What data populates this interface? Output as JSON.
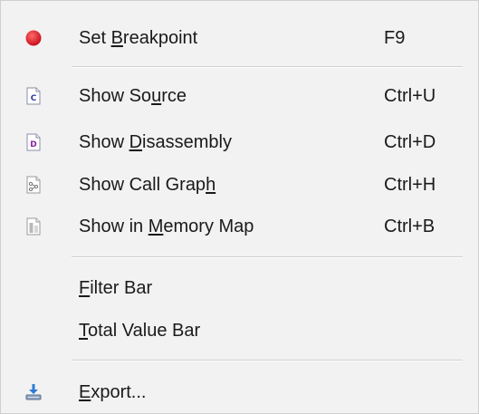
{
  "menu": {
    "items": [
      {
        "pre": "Set ",
        "accel": "B",
        "post": "reakpoint",
        "shortcut": "F9",
        "icon": "breakpoint-icon"
      },
      {
        "pre": "Show So",
        "accel": "u",
        "post": "rce",
        "shortcut": "Ctrl+U",
        "icon": "source-file-icon"
      },
      {
        "pre": "Show ",
        "accel": "D",
        "post": "isassembly",
        "shortcut": "Ctrl+D",
        "icon": "disassembly-icon"
      },
      {
        "pre": "Show Call Grap",
        "accel": "h",
        "post": "",
        "shortcut": "Ctrl+H",
        "icon": "call-graph-icon"
      },
      {
        "pre": "Show in ",
        "accel": "M",
        "post": "emory Map",
        "shortcut": "Ctrl+B",
        "icon": "memory-map-icon"
      },
      {
        "pre": "",
        "accel": "F",
        "post": "ilter Bar",
        "shortcut": ""
      },
      {
        "pre": "",
        "accel": "T",
        "post": "otal Value Bar",
        "shortcut": ""
      },
      {
        "pre": "",
        "accel": "E",
        "post": "xport...",
        "shortcut": "",
        "icon": "export-icon"
      }
    ],
    "icon_glyphs": {
      "source": "C",
      "disassembly": "D"
    }
  },
  "colors": {
    "menu_bg": "#f2f2f2",
    "breakpoint": "#d9232f",
    "source_letter": "#2b3aa0",
    "disassembly_letter": "#8b1fa8",
    "export": "#3b7dd8"
  }
}
